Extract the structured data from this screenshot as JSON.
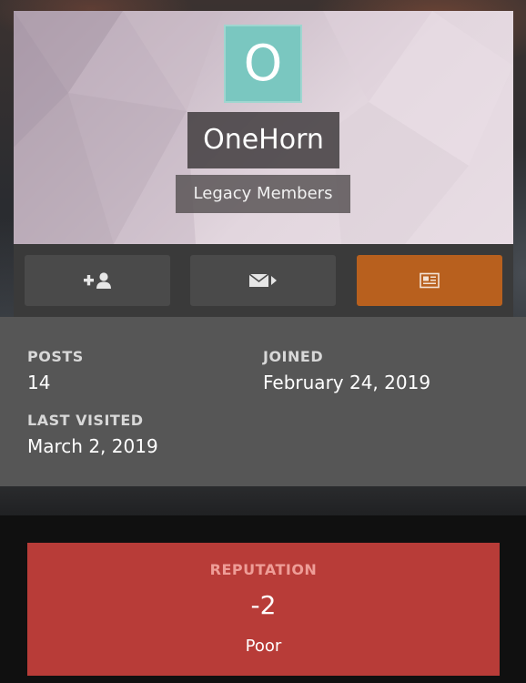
{
  "profile": {
    "avatar_letter": "O",
    "username": "OneHorn",
    "group": "Legacy Members",
    "avatar_color": "#7ac7c0"
  },
  "actions": {
    "follow_icon": "add-user-icon",
    "message_icon": "envelope-icon",
    "content_icon": "newspaper-icon",
    "accent_color": "#b8601e"
  },
  "stats": {
    "posts_label": "POSTS",
    "posts_value": "14",
    "joined_label": "JOINED",
    "joined_value": "February 24, 2019",
    "last_visited_label": "LAST VISITED",
    "last_visited_value": "March 2, 2019"
  },
  "reputation": {
    "label": "REPUTATION",
    "value": "-2",
    "description": "Poor",
    "color": "#b83c38"
  }
}
